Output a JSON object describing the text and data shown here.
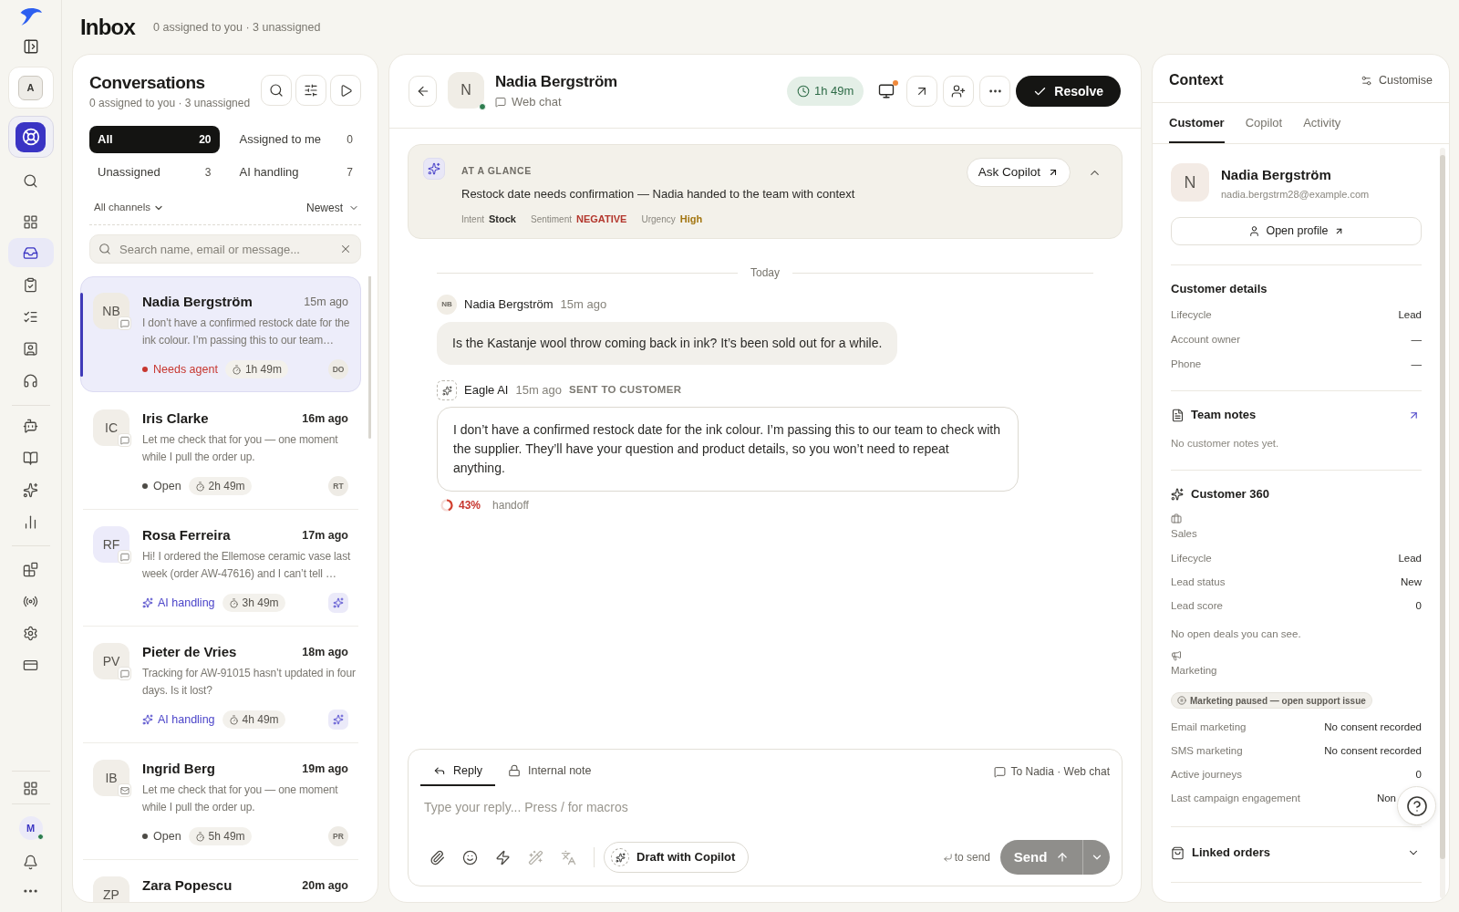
{
  "rail": {
    "workspace": "A",
    "nav": [
      {
        "selected": false
      },
      {
        "selected": false
      },
      {
        "selected": true
      },
      {
        "selected": false
      },
      {
        "selected": false
      },
      {
        "selected": false
      },
      {
        "selected": false
      },
      {
        "selected": false
      },
      {
        "selected": false
      },
      {
        "selected": false
      },
      {
        "selected": false
      },
      {
        "selected": false
      },
      {
        "selected": false
      },
      {
        "selected": false
      },
      {
        "selected": false
      },
      {
        "selected": false
      }
    ],
    "user": {
      "initial": "M",
      "online": true
    }
  },
  "header": {
    "title": "Inbox",
    "subtitle": "0 assigned to you · 3 unassigned"
  },
  "conversations": {
    "title": "Conversations",
    "subtitle": "0 assigned to you · 3 unassigned",
    "filters": [
      {
        "label": "All",
        "count": "20",
        "selected": true
      },
      {
        "label": "Assigned to me",
        "count": "0",
        "selected": false
      },
      {
        "label": "Unassigned",
        "count": "3",
        "selected": false
      },
      {
        "label": "AI handling",
        "count": "7",
        "selected": false
      }
    ],
    "channel_filter": "All channels",
    "sort": "Newest",
    "search": {
      "placeholder": "Search name, email or message..."
    },
    "items": [
      {
        "initials": "NB",
        "color": "#efebe3",
        "channel": {
          "kind": "chat"
        },
        "name": "Nadia Bergström",
        "time": "15m ago",
        "unread": false,
        "preview": "I don’t have a confirmed restock date for the ink colour. I’m passing this to our team…",
        "status": {
          "kind": "urgent",
          "label": "Needs agent"
        },
        "timer": "1h 49m",
        "assignee": {
          "kind": "agent",
          "initials": "DO"
        },
        "selected": true
      },
      {
        "initials": "IC",
        "color": "#f1eee8",
        "channel": {
          "kind": "chat"
        },
        "name": "Iris Clarke",
        "time": "16m ago",
        "unread": true,
        "preview": "Let me check that for you — one moment while I pull the order up.",
        "status": {
          "kind": "open",
          "label": "Open"
        },
        "timer": "2h 49m",
        "assignee": {
          "kind": "agent",
          "initials": "RT"
        },
        "selected": false
      },
      {
        "initials": "RF",
        "color": "#ecebfa",
        "channel": {
          "kind": "chat"
        },
        "name": "Rosa Ferreira",
        "time": "17m ago",
        "unread": true,
        "preview": "Hi! I ordered the Ellemose ceramic vase last week (order AW-47616) and I can’t tell …",
        "status": {
          "kind": "ai",
          "label": "AI handling"
        },
        "timer": "3h 49m",
        "assignee": {
          "kind": "ai"
        },
        "selected": false
      },
      {
        "initials": "PV",
        "color": "#f1eee8",
        "channel": {
          "kind": "chat"
        },
        "name": "Pieter de Vries",
        "time": "18m ago",
        "unread": true,
        "preview": "Tracking for AW-91015 hasn’t updated in four days. Is it lost?",
        "status": {
          "kind": "ai",
          "label": "AI handling"
        },
        "timer": "4h 49m",
        "assignee": {
          "kind": "ai"
        },
        "selected": false
      },
      {
        "initials": "IB",
        "color": "#f1eee8",
        "channel": {
          "kind": "email"
        },
        "name": "Ingrid Berg",
        "time": "19m ago",
        "unread": true,
        "preview": "Let me check that for you — one moment while I pull the order up.",
        "status": {
          "kind": "open",
          "label": "Open"
        },
        "timer": "5h 49m",
        "assignee": {
          "kind": "agent",
          "initials": "PR"
        },
        "selected": false
      },
      {
        "initials": "ZP",
        "color": "#f1eee8",
        "name": "Zara Popescu",
        "time": "20m ago",
        "unread": true,
        "selected": false
      }
    ]
  },
  "conversation": {
    "contact": {
      "initial": "N",
      "name": "Nadia Bergström",
      "channel": "Web chat",
      "online": true
    },
    "timer": "1h 49m",
    "screen_alert": true,
    "resolve": "Resolve",
    "glance": {
      "label": "AT A GLANCE",
      "summary": "Restock date needs confirmation — Nadia handed to the team with context",
      "tags": [
        {
          "label": "Intent",
          "value": "Stock",
          "kind": "neutral"
        },
        {
          "label": "Sentiment",
          "value": "NEGATIVE",
          "kind": "negative"
        },
        {
          "label": "Urgency",
          "value": "High",
          "kind": "warning"
        }
      ],
      "ask": "Ask Copilot",
      "expanded": true
    },
    "divider": "Today",
    "messages": [
      {
        "kind": "customer",
        "initials": "NB",
        "author": "Nadia Bergström",
        "time": "15m ago",
        "text": "Is the Kastanje wool throw coming back in ink? It’s been sold out for a while."
      },
      {
        "kind": "ai",
        "author": "Eagle AI",
        "time": "15m ago",
        "badge": "SENT TO CUSTOMER",
        "text": "I don’t have a confirmed restock date for the ink colour. I’m passing this to our team to check with the supplier. They’ll have your question and product details, so you won’t need to repeat anything.",
        "confidence": {
          "level": 0.43,
          "reading": "43%",
          "label": "handoff"
        }
      }
    ],
    "composer": {
      "modes": [
        {
          "kind": "reply",
          "label": "Reply",
          "selected": true
        },
        {
          "kind": "note",
          "label": "Internal note",
          "selected": false
        }
      ],
      "recipient": "To Nadia · Web chat",
      "placeholder": "Type your reply... Press / for macros",
      "tools": [
        {
          "disabled": false
        },
        {
          "disabled": false
        },
        {
          "disabled": false
        },
        {
          "disabled": true
        },
        {
          "disabled": true
        }
      ],
      "draft": "Draft with Copilot",
      "send_hint": "to send",
      "send": "Send",
      "send_disabled": true
    }
  },
  "context": {
    "title": "Context",
    "customise": "Customise",
    "tabs": [
      {
        "label": "Customer",
        "selected": true
      },
      {
        "label": "Copilot",
        "selected": false
      },
      {
        "label": "Activity",
        "selected": false
      }
    ],
    "customer": {
      "initial": "N",
      "name": "Nadia Bergström",
      "email": "nadia.bergstrm28@example.com",
      "open_profile": "Open profile"
    },
    "details": {
      "title": "Customer details",
      "rows": [
        {
          "label": "Lifecycle",
          "value": "Lead"
        },
        {
          "label": "Account owner",
          "value": "—"
        },
        {
          "label": "Phone",
          "value": "—"
        }
      ]
    },
    "notes": {
      "title": "Team notes",
      "empty": "No customer notes yet."
    },
    "c360": {
      "title": "Customer 360",
      "sales": {
        "title": "Sales",
        "rows": [
          {
            "label": "Lifecycle",
            "value": "Lead"
          },
          {
            "label": "Lead status",
            "value": "New"
          },
          {
            "label": "Lead score",
            "value": "0"
          }
        ],
        "note": "No open deals you can see."
      },
      "marketing": {
        "title": "Marketing",
        "badge": "Marketing paused — open support issue",
        "rows": [
          {
            "label": "Email marketing",
            "value": "No consent recorded"
          },
          {
            "label": "SMS marketing",
            "value": "No consent recorded"
          },
          {
            "label": "Active journeys",
            "value": "0"
          },
          {
            "label": "Last campaign engagement",
            "value": "Non"
          }
        ]
      }
    },
    "linked_orders": {
      "title": "Linked orders",
      "expanded": false
    }
  }
}
